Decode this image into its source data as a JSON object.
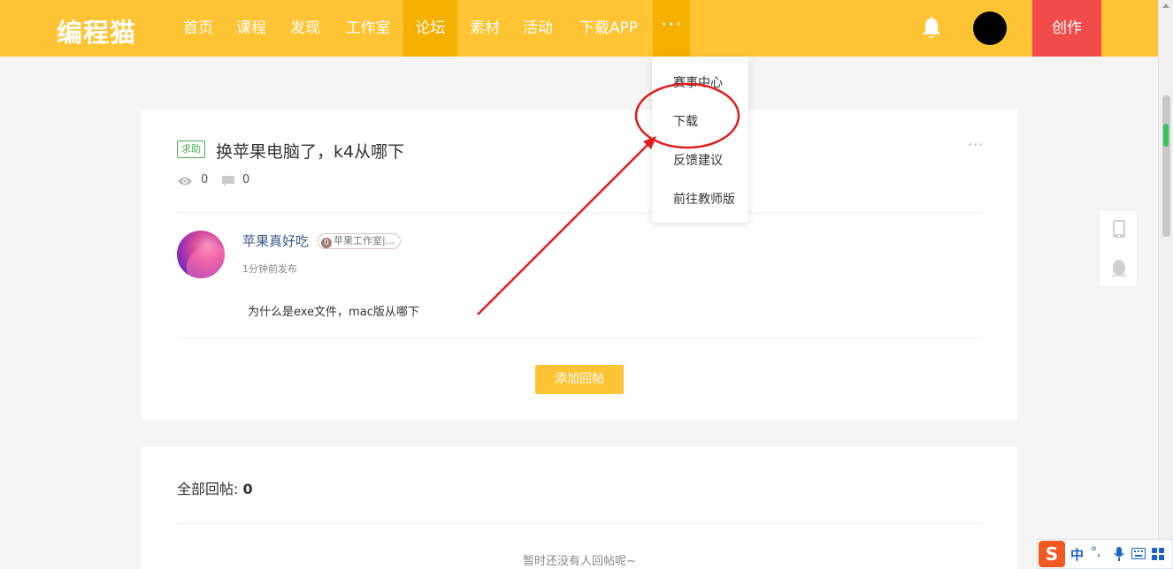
{
  "header": {
    "logo": "编程猫",
    "nav": [
      "首页",
      "课程",
      "发现",
      "工作室",
      "论坛",
      "素材",
      "活动",
      "下载APP"
    ],
    "active_nav": "论坛",
    "more": "···",
    "create": "创作",
    "brand_color": "#fec433",
    "create_color": "#f24b4b"
  },
  "dropdown": {
    "items": [
      "赛事中心",
      "下载",
      "反馈建议",
      "前往教师版"
    ]
  },
  "post": {
    "tag": "求助",
    "title": "换苹果电脑了，k4从哪下",
    "more": "···",
    "views": "0",
    "comments": "0",
    "author": "苹果真好吃",
    "badge_icon": "0",
    "badge": "苹果工作室|...",
    "time": "1分钟前发布",
    "body": "为什么是exe文件，mac版从哪下",
    "add_reply": "添加回帖"
  },
  "replies": {
    "title": "全部回帖: ",
    "count": "0",
    "empty": "暂时还没有人回帖呢~"
  },
  "ime": {
    "logo": "S",
    "mode": "中",
    "punct": "°,",
    "mic": "mic-icon",
    "keyboard": "keyboard-icon",
    "grid": "grid-icon"
  }
}
